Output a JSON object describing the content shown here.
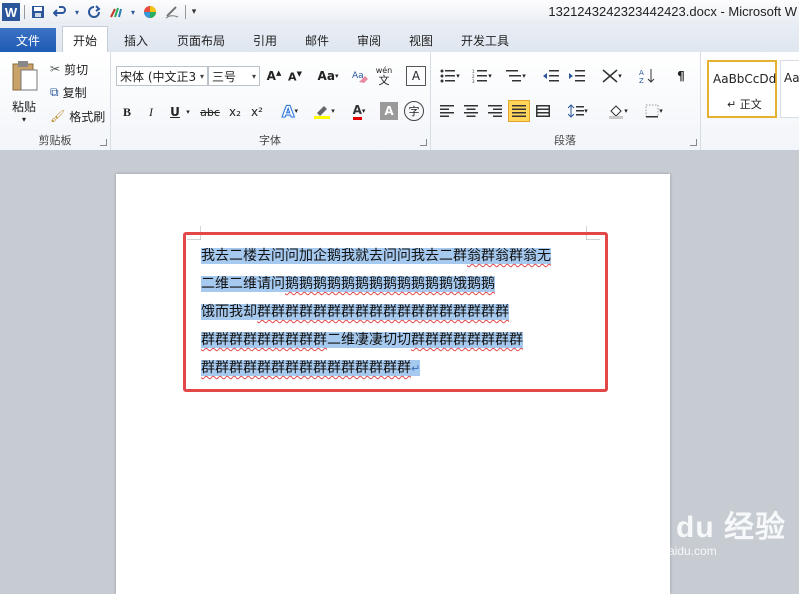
{
  "window": {
    "title": "1321243242323442423.docx - Microsoft W"
  },
  "quick_access": {
    "logo_letter": "W",
    "save_icon": "save-icon",
    "undo_icon": "undo-icon",
    "redo_icon": "redo-icon"
  },
  "tabs": [
    {
      "label": "文件"
    },
    {
      "label": "开始"
    },
    {
      "label": "插入"
    },
    {
      "label": "页面布局"
    },
    {
      "label": "引用"
    },
    {
      "label": "邮件"
    },
    {
      "label": "审阅"
    },
    {
      "label": "视图"
    },
    {
      "label": "开发工具"
    }
  ],
  "clipboard": {
    "group_label": "剪贴板",
    "paste": "粘贴",
    "cut": "剪切",
    "copy": "复制",
    "format_painter": "格式刷"
  },
  "font": {
    "group_label": "字体",
    "font_name": "宋体 (中文正3",
    "font_size": "三号",
    "aa_label": "Aa",
    "bold": "B",
    "italic": "I",
    "underline": "U",
    "strike": "abc",
    "sub": "x₂",
    "sup": "x²",
    "font_color_letter": "A",
    "wen": "wén",
    "wen_char": "文",
    "char_border": "A",
    "enclose": "字"
  },
  "paragraph": {
    "group_label": "段落"
  },
  "styles": {
    "normal_preview": "AaBbCcDd",
    "normal_name": "↵ 正文",
    "next_preview": "Aa"
  },
  "document": {
    "lines": [
      {
        "plain": "我去二楼去问问加企鹅我就去问问我去二群",
        "squiggle": "翁群翁群翁无"
      },
      {
        "plain": "二维二维请问",
        "squiggle": "鹅鹅鹅鹅鹅鹅鹅鹅鹅鹅鹅鹅饿鹅鹅"
      },
      {
        "plain": "饿而我却",
        "squiggle": "群群群群群群群群群群群群群群群群群群"
      },
      {
        "plain": "",
        "squiggle": "群群群群群群群群群",
        "plain2": "二维凄凄切切",
        "squiggle2": "群群群群群群群群"
      },
      {
        "plain": "",
        "squiggle": "群群群群群群群群群群群群群群群",
        "mark": "↵"
      }
    ]
  },
  "watermark": {
    "brand": "Bai du 经验",
    "url": "jingyan.baidu.com"
  },
  "colors": {
    "highlight": "#a6c9ef",
    "annotation": "#e34848",
    "file_tab": "#2b579a"
  }
}
